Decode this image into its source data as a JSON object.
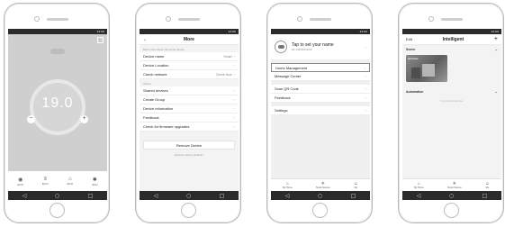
{
  "phone1": {
    "status": "12:00",
    "title": "",
    "mode": "",
    "temperature": "19.0",
    "setting_label": "",
    "minus": "−",
    "plus": "+",
    "tray": [
      {
        "icon": "power-icon",
        "glyph": "◉",
        "label": "ECO"
      },
      {
        "icon": "mode-icon",
        "glyph": "≡",
        "label": "ECO"
      },
      {
        "icon": "lock-icon",
        "glyph": "⌂",
        "label": "ECO"
      },
      {
        "icon": "settings-icon",
        "glyph": "✱",
        "label": "SCH"
      }
    ]
  },
  "phone2": {
    "status": "12:00",
    "title": "More",
    "section1": "Basic information about the device",
    "rows1": [
      {
        "label": "Device name",
        "value": "Smart"
      },
      {
        "label": "Device Location",
        "value": ""
      },
      {
        "label": "Check network",
        "value": "Check Now"
      }
    ],
    "section2": "Others",
    "rows2": [
      {
        "label": "Shared devices",
        "value": ""
      },
      {
        "label": "Create Group",
        "value": ""
      },
      {
        "label": "Device information",
        "value": ""
      },
      {
        "label": "Feedback",
        "value": ""
      },
      {
        "label": "Check for firmware upgrades",
        "value": ""
      }
    ],
    "remove_button": "Remove Device",
    "restore_link": "Restore factory defaults"
  },
  "phone3": {
    "status": "12:00",
    "name": "Tap to set your name",
    "account": "86-13800000000",
    "group1": [
      "Home Management",
      "Message Center"
    ],
    "group2": [
      "Scan QR Code",
      "Feedback"
    ],
    "group3": [
      "Settings"
    ],
    "tabs": [
      {
        "icon": "home-icon",
        "glyph": "⌂",
        "label": "My Home"
      },
      {
        "icon": "smart-icon",
        "glyph": "✳",
        "label": "Smart Scenes"
      },
      {
        "icon": "me-icon",
        "glyph": "☺",
        "label": "Me"
      }
    ]
  },
  "phone4": {
    "status": "12:00",
    "edit": "Edit",
    "title": "Intelligent",
    "add": "+",
    "scene_label": "Scene",
    "scene_card": "at home",
    "automation_label": "Automation",
    "automation_empty": "No smart devices here",
    "tabs": [
      {
        "icon": "home-icon",
        "glyph": "⌂",
        "label": "My Home"
      },
      {
        "icon": "smart-icon",
        "glyph": "✳",
        "label": "Smart Scenes"
      },
      {
        "icon": "me-icon",
        "glyph": "☺",
        "label": "Me"
      }
    ]
  },
  "android_nav": {
    "back": "◁",
    "home": "○",
    "recent": "□"
  }
}
